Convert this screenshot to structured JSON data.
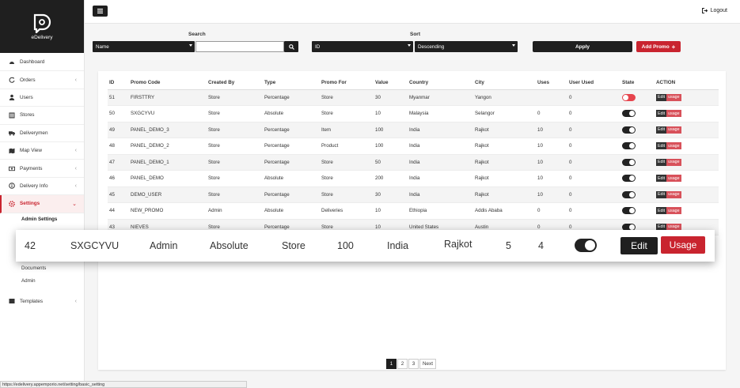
{
  "brand": {
    "name": "eDelivery"
  },
  "sidebar": {
    "items": [
      {
        "label": "Dashboard",
        "icon": "dashboard-icon",
        "chevron": false
      },
      {
        "label": "Orders",
        "icon": "refresh-icon",
        "chevron": true
      },
      {
        "label": "Users",
        "icon": "user-icon",
        "chevron": false
      },
      {
        "label": "Stores",
        "icon": "store-icon",
        "chevron": false
      },
      {
        "label": "Deliverymen",
        "icon": "truck-icon",
        "chevron": false
      },
      {
        "label": "Map View",
        "icon": "map-icon",
        "chevron": true
      },
      {
        "label": "Payments",
        "icon": "money-icon",
        "chevron": true
      },
      {
        "label": "Delivery Info",
        "icon": "info-icon",
        "chevron": true
      },
      {
        "label": "Settings",
        "icon": "gear-icon",
        "chevron": true
      }
    ],
    "settings_sub": [
      "Admin Settings",
      "Documents",
      "Admin"
    ],
    "templates_label": "Templates"
  },
  "topbar": {
    "logout_label": "Logout"
  },
  "filters": {
    "search_label": "Search",
    "search_by": "Name",
    "search_value": "",
    "sort_label": "Sort",
    "sort_field": "ID",
    "sort_order": "Descending",
    "apply_label": "Apply",
    "add_label": "Add Promo"
  },
  "table": {
    "headers": [
      "ID",
      "Promo Code",
      "Created By",
      "Type",
      "Promo For",
      "Value",
      "Country",
      "City",
      "Uses",
      "User Used",
      "State",
      "ACTION"
    ],
    "edit_label": "Edit",
    "usage_label": "usage",
    "rows": [
      {
        "id": "51",
        "code": "FIRSTTRY",
        "created_by": "Store",
        "type": "Percentage",
        "promo_for": "Store",
        "value": "30",
        "country": "Myanmar",
        "city": "Yangon",
        "uses": "",
        "user_used": "0",
        "state": "off"
      },
      {
        "id": "50",
        "code": "SXGCYVU",
        "created_by": "Store",
        "type": "Absolute",
        "promo_for": "Store",
        "value": "10",
        "country": "Malaysia",
        "city": "Selangor",
        "uses": "0",
        "user_used": "0",
        "state": "on"
      },
      {
        "id": "49",
        "code": "PANEL_DEMO_3",
        "created_by": "Store",
        "type": "Percentage",
        "promo_for": "Item",
        "value": "100",
        "country": "India",
        "city": "Rajkot",
        "uses": "10",
        "user_used": "0",
        "state": "on"
      },
      {
        "id": "48",
        "code": "PANEL_DEMO_2",
        "created_by": "Store",
        "type": "Percentage",
        "promo_for": "Product",
        "value": "100",
        "country": "India",
        "city": "Rajkot",
        "uses": "10",
        "user_used": "0",
        "state": "on"
      },
      {
        "id": "47",
        "code": "PANEL_DEMO_1",
        "created_by": "Store",
        "type": "Percentage",
        "promo_for": "Store",
        "value": "50",
        "country": "India",
        "city": "Rajkot",
        "uses": "10",
        "user_used": "0",
        "state": "on"
      },
      {
        "id": "46",
        "code": "PANEL_DEMO",
        "created_by": "Store",
        "type": "Absolute",
        "promo_for": "Store",
        "value": "200",
        "country": "India",
        "city": "Rajkot",
        "uses": "10",
        "user_used": "0",
        "state": "on"
      },
      {
        "id": "45",
        "code": "DEMO_USER",
        "created_by": "Store",
        "type": "Percentage",
        "promo_for": "Store",
        "value": "30",
        "country": "India",
        "city": "Rajkot",
        "uses": "10",
        "user_used": "0",
        "state": "on"
      },
      {
        "id": "44",
        "code": "NEW_PROMO",
        "created_by": "Admin",
        "type": "Absolute",
        "promo_for": "Deliveries",
        "value": "10",
        "country": "Ethiopia",
        "city": "Addis Ababa",
        "uses": "0",
        "user_used": "0",
        "state": "on"
      },
      {
        "id": "43",
        "code": "NIEVES",
        "created_by": "Store",
        "type": "Percentage",
        "promo_for": "Store",
        "value": "10",
        "country": "United States",
        "city": "Austin",
        "uses": "0",
        "user_used": "0",
        "state": "on"
      }
    ]
  },
  "zoom_row": {
    "id": "42",
    "code": "SXGCYVU",
    "created_by": "Admin",
    "type": "Absolute",
    "promo_for": "Store",
    "value": "100",
    "country": "India",
    "city": "Rajkot",
    "uses": "5",
    "user_used": "4",
    "state": "on",
    "edit_label": "Edit",
    "usage_label": "Usage"
  },
  "pagination": {
    "pages": [
      "1",
      "2",
      "3"
    ],
    "active": "1",
    "next_label": "Next"
  },
  "statusbar": {
    "url": "https://edelivery.appemporio.net/setting/basic_setting"
  },
  "colors": {
    "accent": "#c9242f",
    "dark": "#1f1f1f",
    "toggle_off": "#e6444d"
  }
}
